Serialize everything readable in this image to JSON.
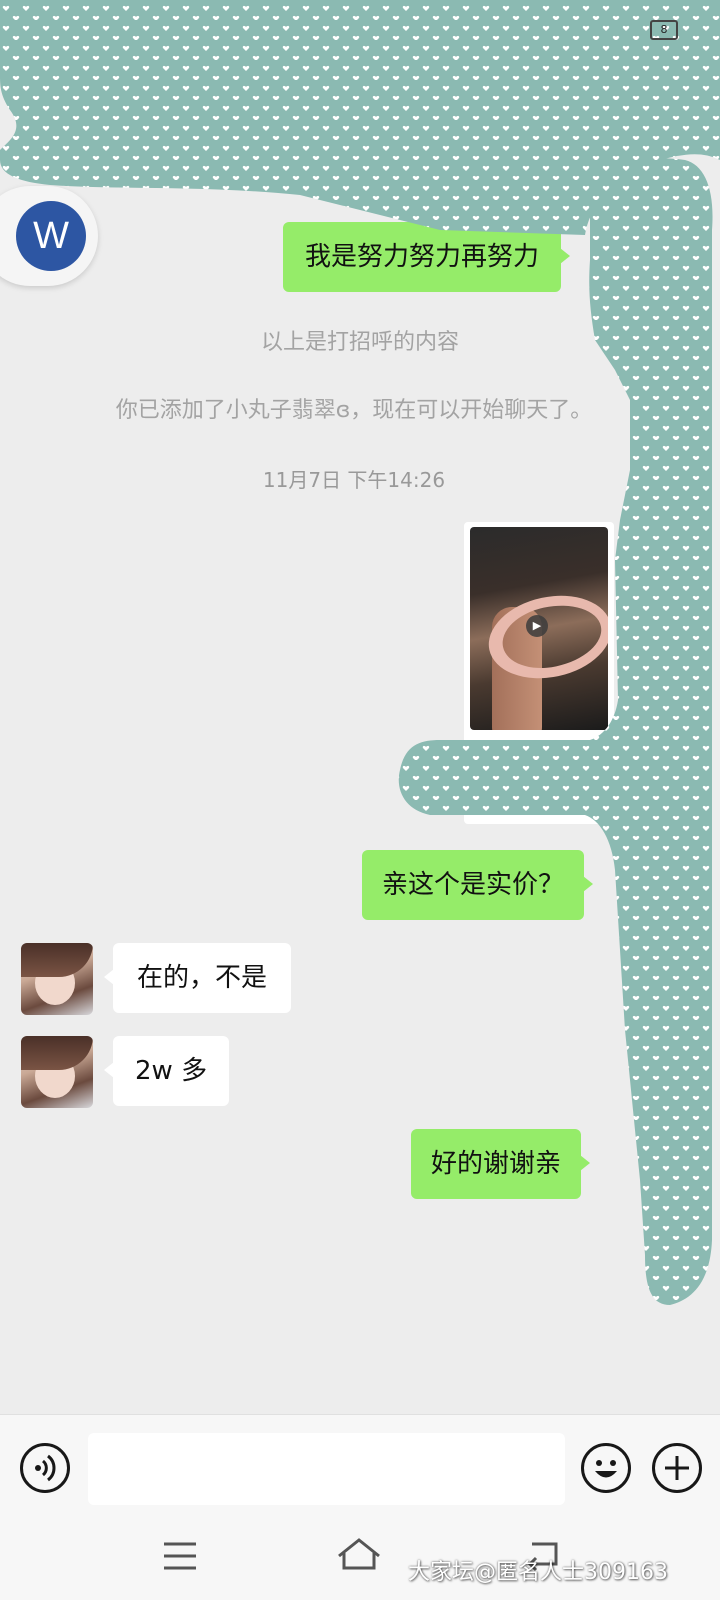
{
  "header": {
    "contact_initial": "W",
    "battery_level": "8"
  },
  "messages": [
    {
      "id": "m1",
      "side": "me",
      "text": "我是努力努力再努力"
    },
    {
      "id": "m2",
      "side": "me",
      "text": "亲这个是实价？"
    },
    {
      "id": "m3",
      "side": "other",
      "text": "在的，不是"
    },
    {
      "id": "m4",
      "side": "other",
      "text": "2w 多"
    },
    {
      "id": "m5",
      "side": "me",
      "text": "好的谢谢亲"
    }
  ],
  "system": {
    "greeting_notice": "以上是打招呼的内容",
    "added_notice": "你已添加了小丸子翡翠ɞ，现在可以开始聊天了。",
    "timestamp": "11月7日  下午14:26"
  },
  "input_bar": {
    "voice_icon": "voice-icon",
    "emoji_icon": "emoji-icon",
    "plus_icon": "plus-icon",
    "placeholder": ""
  },
  "nav_bar": {
    "menu_icon": "menu-icon",
    "home_icon": "home-icon",
    "back_icon": "back-icon"
  },
  "watermark": "大家坛@匿名人士309163",
  "colors": {
    "my_bubble": "#95ec69",
    "other_bubble": "#ffffff",
    "chat_bg": "#ededed",
    "redaction_pattern": "#8bbab2"
  }
}
